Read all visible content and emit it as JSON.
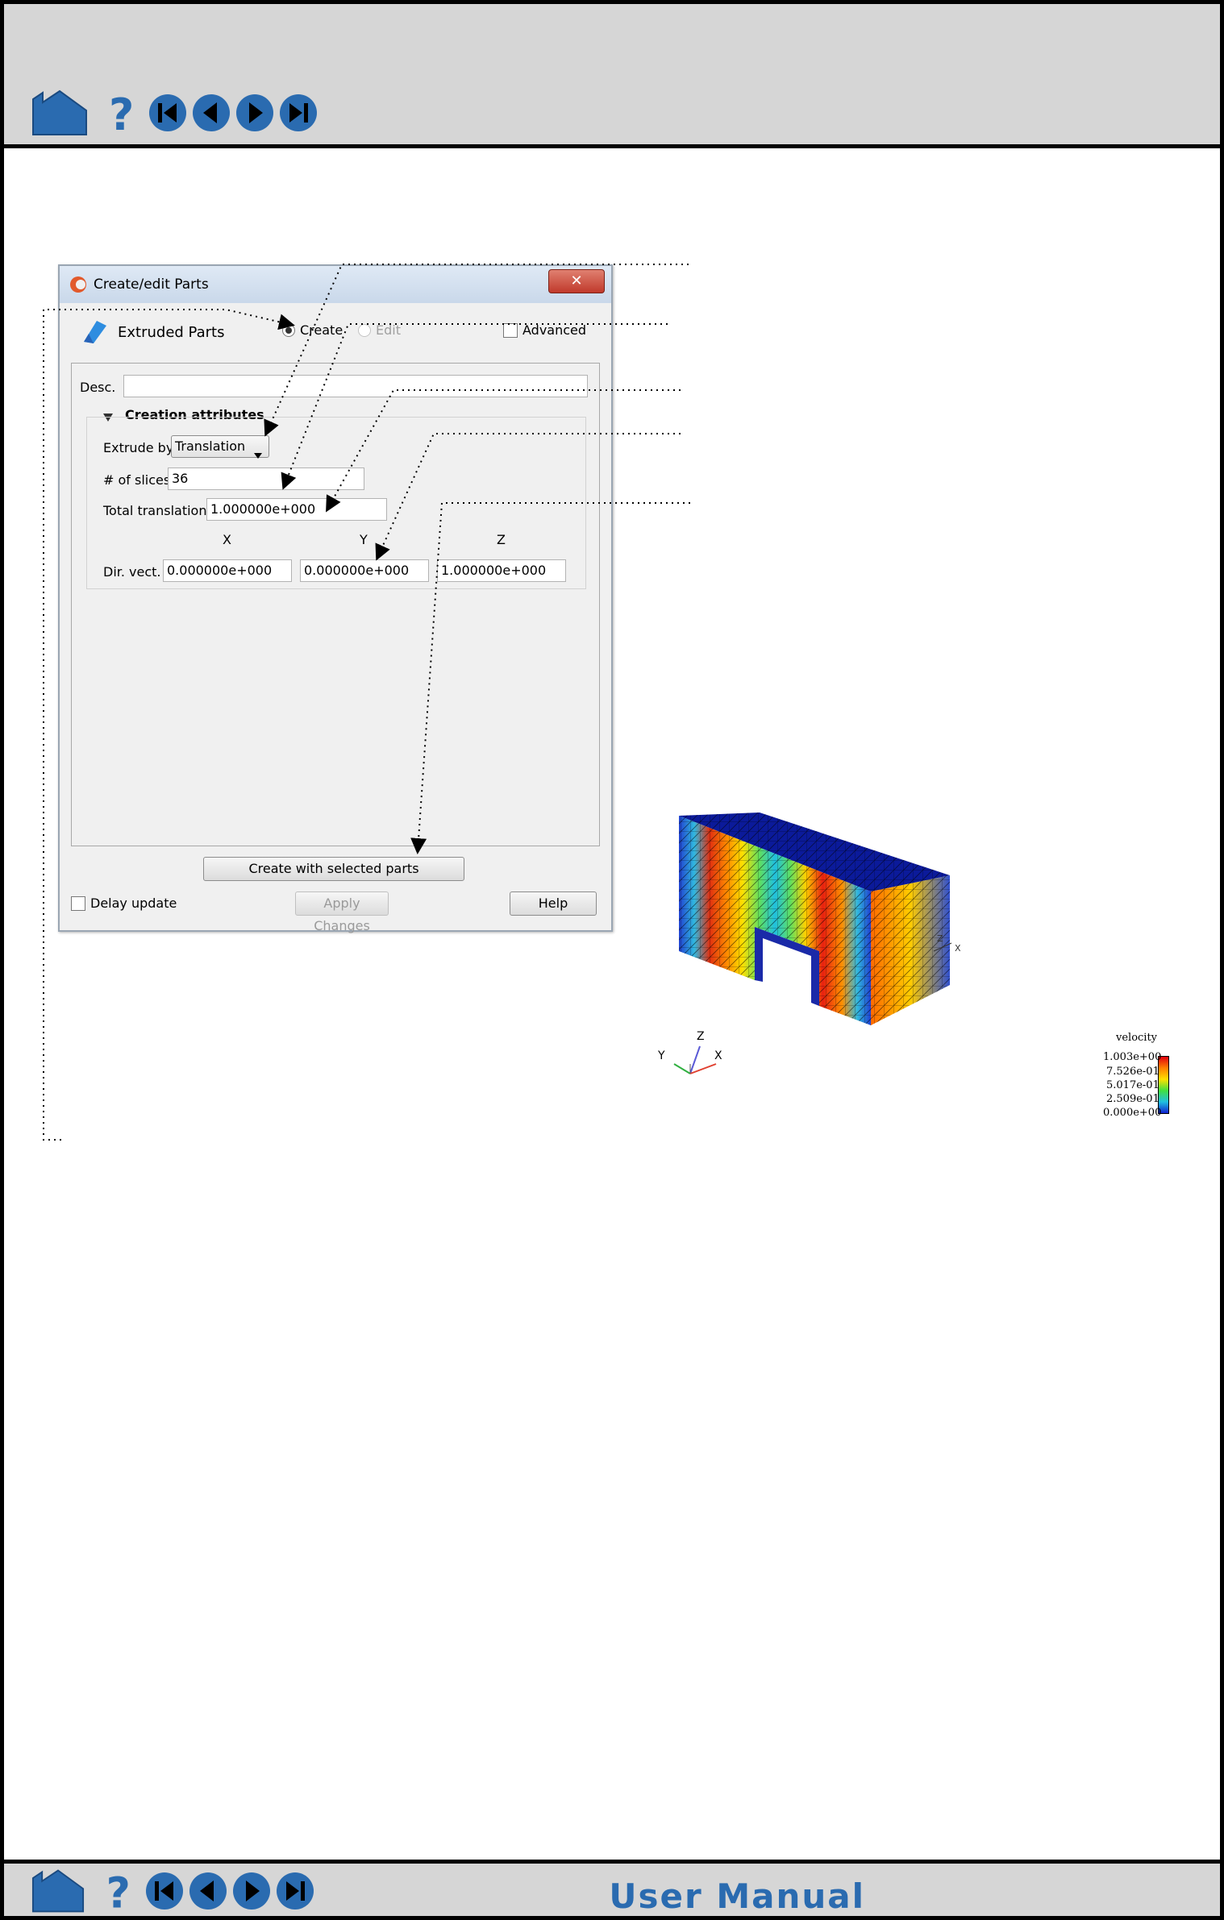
{
  "nav": {
    "icons": [
      "home-icon",
      "help-icon",
      "first-page-icon",
      "previous-page-icon",
      "next-page-icon",
      "last-page-icon"
    ],
    "footer_title": "User Manual"
  },
  "dialog": {
    "title": "Create/edit Parts",
    "close": "✕",
    "part_type": "Extruded Parts",
    "mode_create": "Create",
    "mode_edit": "Edit",
    "advanced": "Advanced",
    "desc_label": "Desc.",
    "desc_value": "",
    "section_title": "Creation attributes",
    "extrude_by_label": "Extrude by",
    "extrude_by_value": "Translation",
    "slices_label": "# of slices",
    "slices_value": "36",
    "total_translation_label": "Total translation",
    "total_translation_value": "1.000000e+000",
    "col_x": "X",
    "col_y": "Y",
    "col_z": "Z",
    "dir_vect_label": "Dir. vect.",
    "dir_x": "0.000000e+000",
    "dir_y": "0.000000e+000",
    "dir_z": "1.000000e+000",
    "create_button": "Create with selected parts",
    "delay_update": "Delay update",
    "apply_changes": "Apply Changes",
    "help": "Help"
  },
  "viewport": {
    "axis_x": "X",
    "axis_y": "Y",
    "axis_z": "Z",
    "legend": {
      "title": "velocity",
      "ticks": [
        "1.003e+00",
        "7.526e-01",
        "5.017e-01",
        "2.509e-01",
        "0.000e+00"
      ]
    }
  },
  "colors": {
    "accent_blue": "#2a6bb0",
    "bar_grey": "#d6d6d6"
  }
}
